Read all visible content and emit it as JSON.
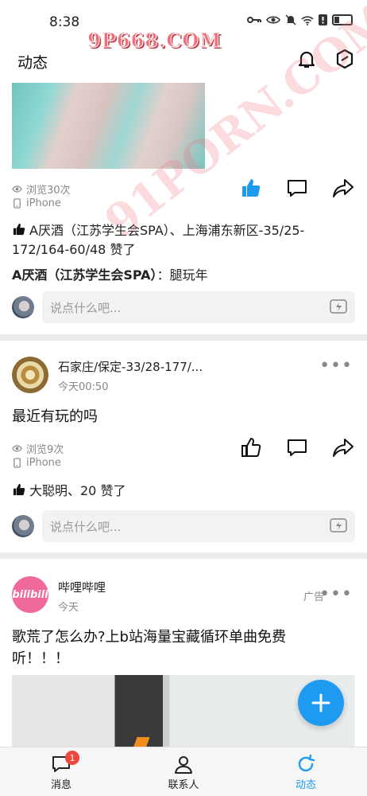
{
  "status_bar": {
    "time": "8:38"
  },
  "watermarks": {
    "top": "9P668.COM",
    "diagonal": "91PORN.COM"
  },
  "header": {
    "title": "动态",
    "icons": [
      "bell-icon",
      "hexagon-icon"
    ]
  },
  "posts": [
    {
      "views": "浏览30次",
      "device": "iPhone",
      "liked": true,
      "likes_text": "A厌酒（江苏学生会SPA）、上海浦东新区-35/25-172/164-60/48 赞了",
      "comment": {
        "author": "A厌酒（江苏学生会SPA）",
        "text": "：腿玩年"
      },
      "comment_placeholder": "说点什么吧..."
    },
    {
      "author": "石家庄/保定-33/28-177/...",
      "time": "今天00:50",
      "text": "最近有玩的吗",
      "views": "浏览9次",
      "device": "iPhone",
      "liked": false,
      "likes_text": "大聪明、20 赞了",
      "comment_placeholder": "说点什么吧...",
      "more": "•••"
    },
    {
      "author": "哔哩哔哩",
      "avatar_text": "bilibili",
      "time": "今天",
      "ad_label": "广告",
      "text": "歌荒了怎么办?上b站海量宝藏循环单曲免费听！！！",
      "more": "•••"
    }
  ],
  "tabs": [
    {
      "label": "消息",
      "badge": "1",
      "icon": "message-icon"
    },
    {
      "label": "联系人",
      "icon": "contact-icon"
    },
    {
      "label": "动态",
      "icon": "refresh-icon",
      "active": true
    }
  ],
  "colors": {
    "accent": "#1e9af0",
    "badge": "#f0473c"
  }
}
